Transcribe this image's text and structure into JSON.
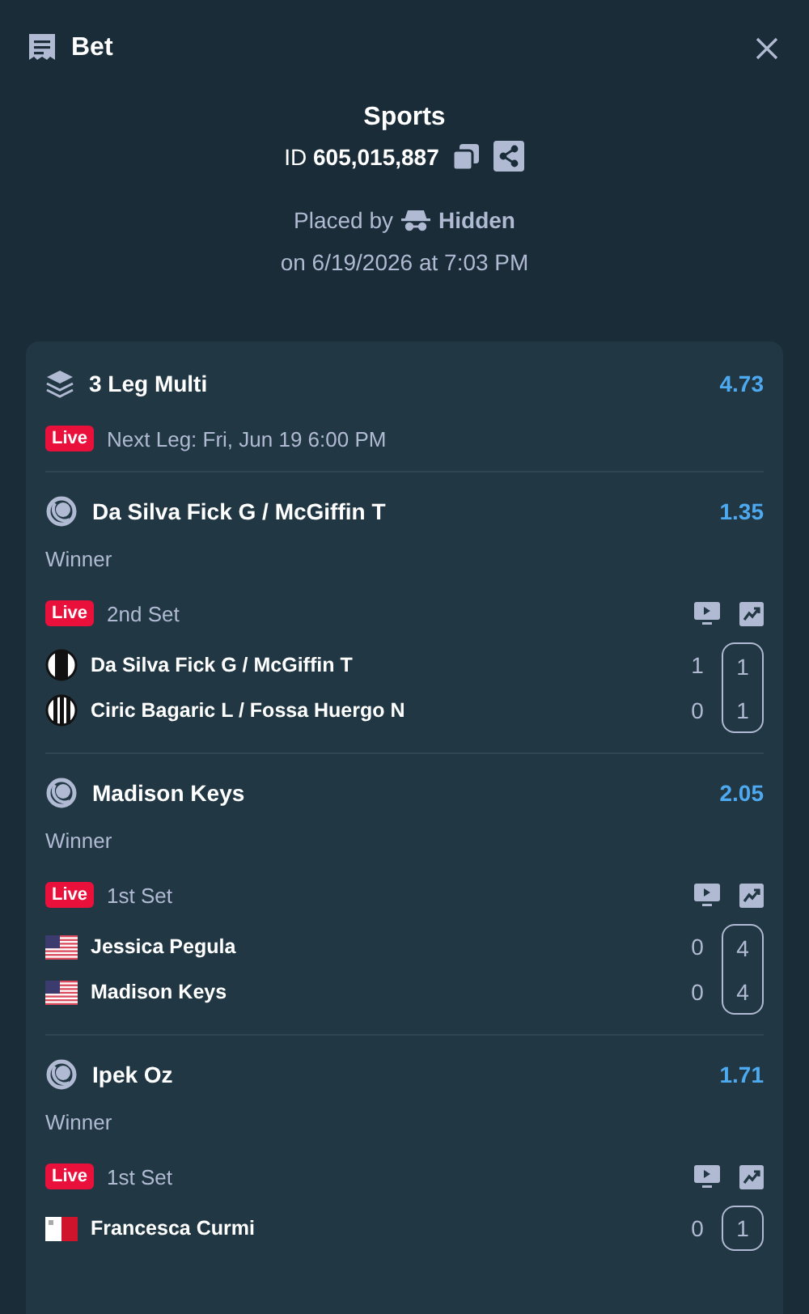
{
  "header": {
    "title": "Bet"
  },
  "summary": {
    "sport": "Sports",
    "id_label": "ID",
    "id_value": "605,015,887",
    "placed_by_label": "Placed by",
    "placed_by": "Hidden",
    "placed_on": "on 6/19/2026 at 7:03 PM"
  },
  "multi": {
    "title": "3 Leg Multi",
    "odds": "4.73",
    "live_badge": "Live",
    "next_leg": "Next Leg: Fri, Jun 19 6:00 PM"
  },
  "legs": [
    {
      "title": "Da Silva Fick G / McGiffin T",
      "odds": "1.35",
      "market": "Winner",
      "live_badge": "Live",
      "period": "2nd Set",
      "participants": [
        {
          "kind": "jersey-half",
          "name": "Da Silva Fick G / McGiffin T",
          "sets": "1",
          "games": "1"
        },
        {
          "kind": "jersey-stripes",
          "name": "Ciric Bagaric L / Fossa Huergo N",
          "sets": "0",
          "games": "1"
        }
      ]
    },
    {
      "title": "Madison Keys",
      "odds": "2.05",
      "market": "Winner",
      "live_badge": "Live",
      "period": "1st Set",
      "participants": [
        {
          "kind": "flag-us",
          "name": "Jessica Pegula",
          "sets": "0",
          "games": "4"
        },
        {
          "kind": "flag-us",
          "name": "Madison Keys",
          "sets": "0",
          "games": "4"
        }
      ]
    },
    {
      "title": "Ipek Oz",
      "odds": "1.71",
      "market": "Winner",
      "live_badge": "Live",
      "period": "1st Set",
      "participants": [
        {
          "kind": "flag-mt",
          "name": "Francesca Curmi",
          "sets": "0",
          "games": "1"
        }
      ]
    }
  ]
}
